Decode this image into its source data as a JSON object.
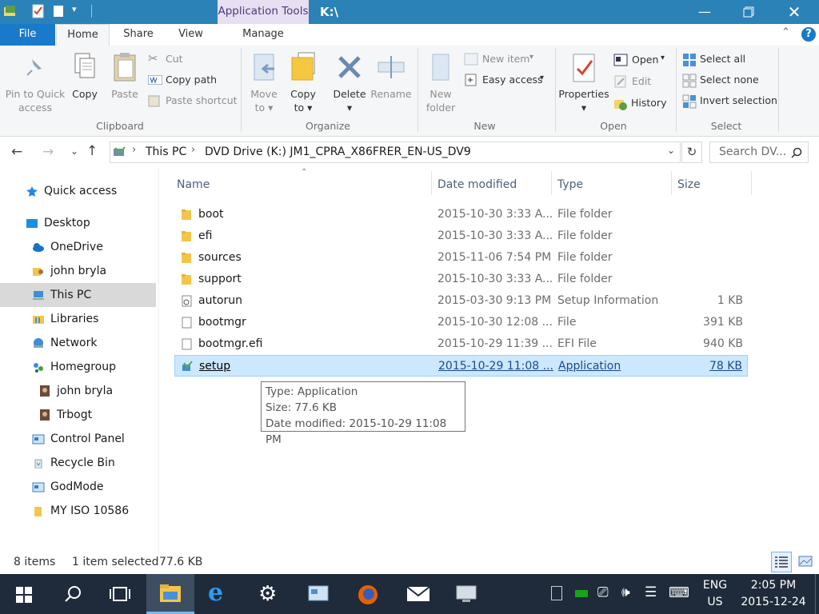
{
  "window": {
    "title": "K:\\",
    "context_tab": "Application Tools",
    "accent": "#2b82b6"
  },
  "tabs": {
    "file": "File",
    "home": "Home",
    "share": "Share",
    "view": "View",
    "manage": "Manage"
  },
  "ribbon": {
    "clipboard": {
      "group": "Clipboard",
      "pin_line1": "Pin to Quick",
      "pin_line2": "access",
      "copy": "Copy",
      "paste": "Paste",
      "cut": "Cut",
      "copy_path": "Copy path",
      "paste_shortcut": "Paste shortcut"
    },
    "organize": {
      "group": "Organize",
      "move_line1": "Move",
      "move_line2": "to",
      "copy_line1": "Copy",
      "copy_line2": "to",
      "delete": "Delete",
      "rename": "Rename"
    },
    "new": {
      "group": "New",
      "new_folder_line1": "New",
      "new_folder_line2": "folder",
      "new_item": "New item",
      "easy_access": "Easy access"
    },
    "open": {
      "group": "Open",
      "properties": "Properties",
      "open": "Open",
      "edit": "Edit",
      "history": "History"
    },
    "select": {
      "group": "Select",
      "select_all": "Select all",
      "select_none": "Select none",
      "invert_selection": "Invert selection"
    }
  },
  "address": {
    "crumbs": [
      "This PC",
      "DVD Drive (K:) JM1_CPRA_X86FRER_EN-US_DV9"
    ],
    "search_placeholder": "Search DV..."
  },
  "nav": [
    {
      "label": "Quick access",
      "icon": "star-icon"
    },
    {
      "label": "Desktop",
      "icon": "desktop-icon"
    },
    {
      "label": "OneDrive",
      "icon": "cloud-icon"
    },
    {
      "label": "john bryla",
      "icon": "user-folder-icon"
    },
    {
      "label": "This PC",
      "icon": "computer-icon"
    },
    {
      "label": "Libraries",
      "icon": "library-icon"
    },
    {
      "label": "Network",
      "icon": "network-icon"
    },
    {
      "label": "Homegroup",
      "icon": "homegroup-icon"
    },
    {
      "label": "john bryla",
      "icon": "user-avatar-icon"
    },
    {
      "label": "Trbogt",
      "icon": "user-avatar-icon"
    },
    {
      "label": "Control Panel",
      "icon": "control-panel-icon"
    },
    {
      "label": "Recycle Bin",
      "icon": "recycle-bin-icon"
    },
    {
      "label": "GodMode",
      "icon": "control-panel-icon"
    },
    {
      "label": "MY ISO 10586",
      "icon": "folder-icon"
    }
  ],
  "columns": {
    "name": "Name",
    "date": "Date modified",
    "type": "Type",
    "size": "Size"
  },
  "files": [
    {
      "name": "boot",
      "date": "2015-10-30 3:33 A...",
      "type": "File folder",
      "size": "",
      "icon": "folder-icon"
    },
    {
      "name": "efi",
      "date": "2015-10-30 3:33 A...",
      "type": "File folder",
      "size": "",
      "icon": "folder-icon"
    },
    {
      "name": "sources",
      "date": "2015-11-06 7:54 PM",
      "type": "File folder",
      "size": "",
      "icon": "folder-icon"
    },
    {
      "name": "support",
      "date": "2015-10-30 3:33 A...",
      "type": "File folder",
      "size": "",
      "icon": "folder-icon"
    },
    {
      "name": "autorun",
      "date": "2015-03-30 9:13 PM",
      "type": "Setup Information",
      "size": "1 KB",
      "icon": "setup-info-icon"
    },
    {
      "name": "bootmgr",
      "date": "2015-10-30 12:08 ...",
      "type": "File",
      "size": "391 KB",
      "icon": "file-icon"
    },
    {
      "name": "bootmgr.efi",
      "date": "2015-10-29 11:39 ...",
      "type": "EFI File",
      "size": "940 KB",
      "icon": "file-icon"
    },
    {
      "name": "setup",
      "date": "2015-10-29 11:08 ...",
      "type": "Application",
      "size": "78 KB",
      "icon": "setup-app-icon"
    }
  ],
  "tooltip": {
    "type": "Type: Application",
    "size": "Size: 77.6 KB",
    "date": "Date modified: 2015-10-29 11:08 PM"
  },
  "status": {
    "items": "8 items",
    "selected": "1 item selected",
    "size": "77.6 KB"
  },
  "taskbar": {
    "lang1": "ENG",
    "lang2": "US",
    "time": "2:05 PM",
    "date": "2015-12-24"
  }
}
